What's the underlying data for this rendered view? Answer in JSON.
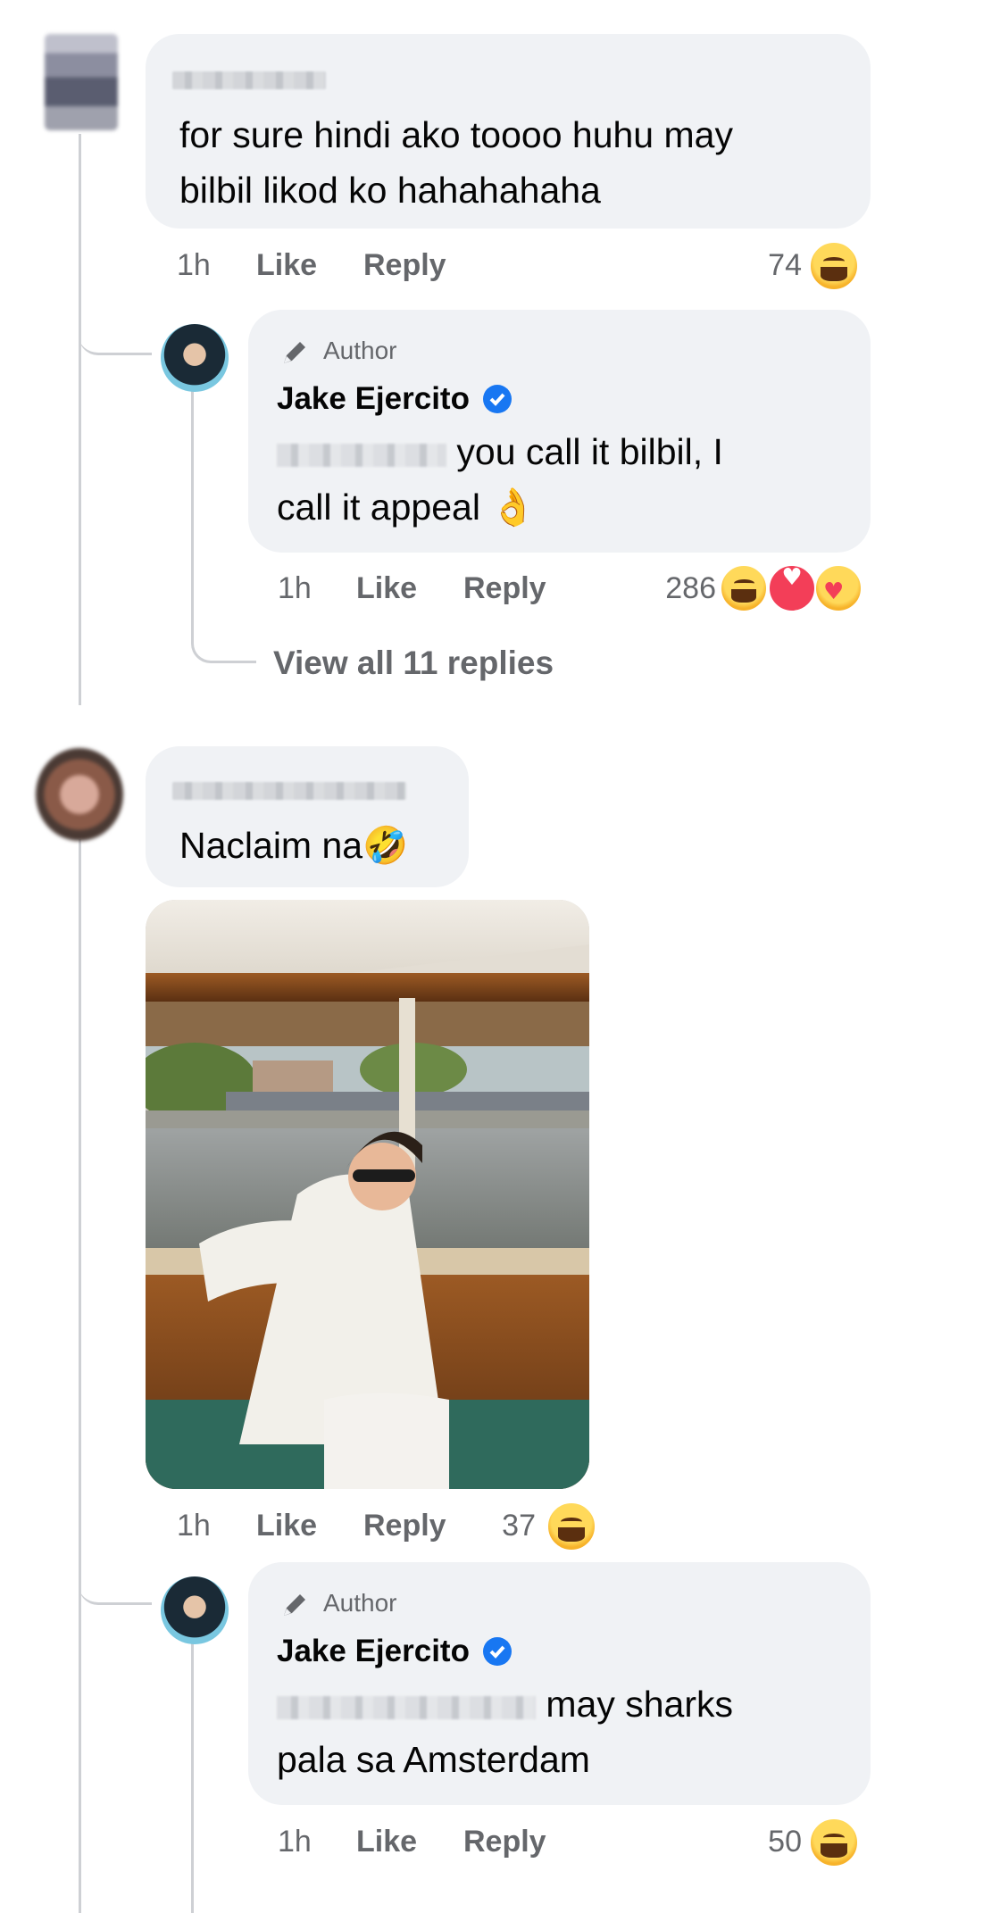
{
  "comments": [
    {
      "text_line1": "for sure hindi ako toooo huhu may",
      "text_line2": "bilbil likod ko hahahahaha",
      "time": "1h",
      "like": "Like",
      "reply": "Reply",
      "reaction_count": "74",
      "reactions": [
        "haha-emoji"
      ]
    },
    {
      "author_badge": "Author",
      "name": "Jake Ejercito",
      "text_line1": "you call it bilbil, I",
      "text_line2": "call it appeal",
      "trailing_emoji": "👌",
      "time": "1h",
      "like": "Like",
      "reply": "Reply",
      "reaction_count": "286",
      "reactions": [
        "haha-emoji",
        "love-emoji",
        "care-emoji"
      ]
    },
    {
      "view_replies": "View all 11 replies"
    },
    {
      "text": "Naclaim na",
      "trailing_emoji": "🤣",
      "time": "1h",
      "like": "Like",
      "reply": "Reply",
      "reaction_count": "37",
      "reactions": [
        "haha-emoji"
      ]
    },
    {
      "author_badge": "Author",
      "name": "Jake Ejercito",
      "text_line1": "may sharks",
      "text_line2": "pala sa Amsterdam",
      "time": "1h",
      "like": "Like",
      "reply": "Reply",
      "reaction_count": "50",
      "reactions": [
        "haha-emoji"
      ]
    }
  ],
  "colors": {
    "bubble": "#f0f2f5",
    "meta_text": "#65676b",
    "verified_blue": "#1877f2",
    "thread_line": "#ced0d4"
  }
}
